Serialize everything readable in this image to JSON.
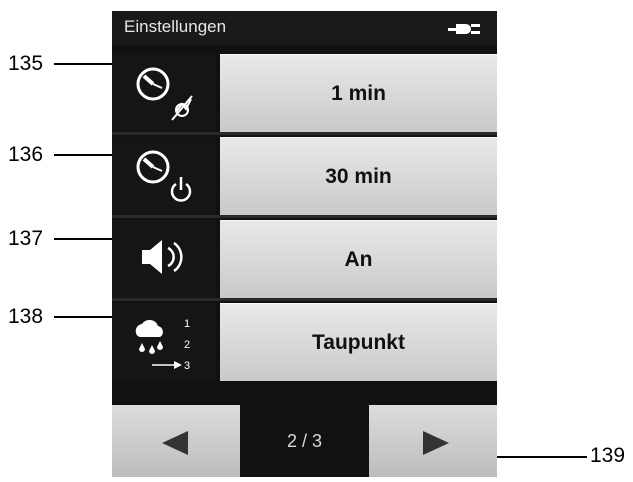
{
  "header": {
    "title": "Einstellungen",
    "power_icon": "plug-icon"
  },
  "settings": [
    {
      "value": "1 min",
      "icon": "timer-sleep-icon",
      "callout": "135"
    },
    {
      "value": "30 min",
      "icon": "timer-power-off-icon",
      "callout": "136"
    },
    {
      "value": "An",
      "icon": "speaker-icon",
      "callout": "137"
    },
    {
      "value": "Taupunkt",
      "icon": "dewpoint-order-icon",
      "callout": "138",
      "icon_labels": [
        "1",
        "2",
        "3"
      ]
    }
  ],
  "navigation": {
    "page_indicator": "2 / 3",
    "prev_icon": "left-arrow-icon",
    "next_icon": "right-arrow-icon",
    "callout": "139"
  },
  "colors": {
    "screen_bg": "#111111",
    "button_bg": "#d6d6d6",
    "text_light": "#e6e6e6"
  }
}
